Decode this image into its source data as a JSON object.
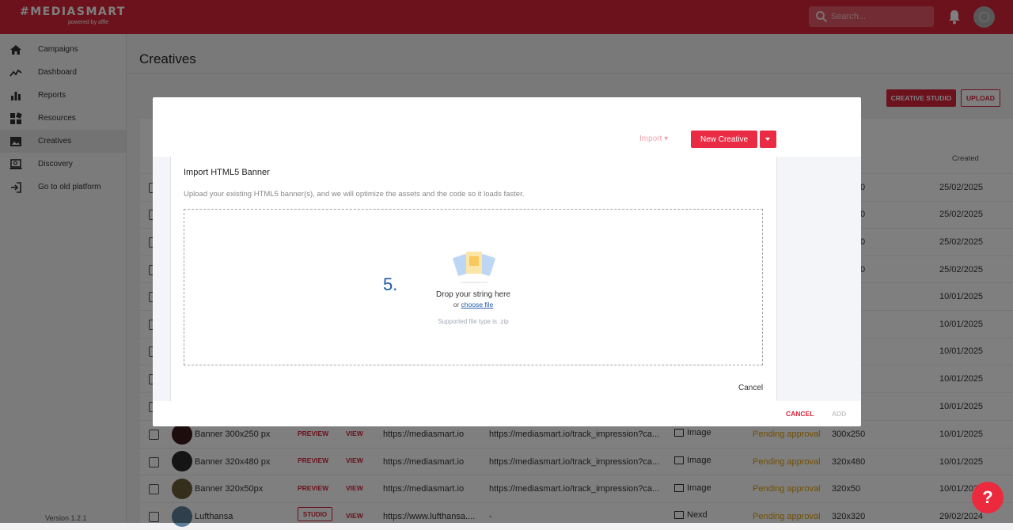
{
  "header": {
    "logo": "#MEDIASMART",
    "logo_sub": "powered by affle",
    "search_placeholder": "Search..."
  },
  "sidebar": {
    "items": [
      {
        "label": "Campaigns"
      },
      {
        "label": "Dashboard"
      },
      {
        "label": "Reports"
      },
      {
        "label": "Resources"
      },
      {
        "label": "Creatives"
      },
      {
        "label": "Discovery"
      },
      {
        "label": "Go to old platform"
      }
    ],
    "version": "Version 1.2.1"
  },
  "page": {
    "title": "Creatives",
    "creative_studio": "CREATIVE STUDIO",
    "upload": "UPLOAD",
    "col_created": "Created"
  },
  "rows_bg": [
    {
      "date": "25/02/2025",
      "size": "0"
    },
    {
      "date": "25/02/2025",
      "size": "0"
    },
    {
      "date": "25/02/2025",
      "size": "0"
    },
    {
      "date": "25/02/2025",
      "size": "0"
    },
    {
      "date": "10/01/2025",
      "size": ""
    },
    {
      "date": "10/01/2025",
      "size": ""
    },
    {
      "date": "10/01/2025",
      "size": ""
    },
    {
      "date": "10/01/2025",
      "size": ""
    },
    {
      "date": "10/01/2025",
      "size": ""
    }
  ],
  "rows": [
    {
      "name": "Banner 300x250 px",
      "action": "PREVIEW",
      "view": "VIEW",
      "url1": "https://mediasmart.io",
      "url2": "https://mediasmart.io/track_impression?ca...",
      "type": "Image",
      "status": "Pending approval",
      "size": "300x250",
      "date": "10/01/2025"
    },
    {
      "name": "Banner 320x480 px",
      "action": "PREVIEW",
      "view": "VIEW",
      "url1": "https://mediasmart.io",
      "url2": "https://mediasmart.io/track_impression?ca...",
      "type": "Image",
      "status": "Pending approval",
      "size": "320x480",
      "date": "10/01/2025"
    },
    {
      "name": "Banner 320x50px",
      "action": "PREVIEW",
      "view": "VIEW",
      "url1": "https://mediasmart.io",
      "url2": "https://mediasmart.io/track_impression?ca...",
      "type": "Image",
      "status": "Pending approval",
      "size": "320x50",
      "date": "10/01/2025"
    },
    {
      "name": "Lufthansa",
      "action": "STUDIO",
      "view": "VIEW",
      "url1": "https://www.lufthansa....",
      "url2": "-",
      "type": "Nexd",
      "status": "Pending approval",
      "size": "320x320",
      "date": "29/02/2024"
    }
  ],
  "modal": {
    "import_label": "Import",
    "new_creative": "New Creative",
    "card_title": "Import HTML5 Banner",
    "card_desc": "Upload your existing HTML5 banner(s), and we will optimize the assets and the code so it loads faster.",
    "step": "5.",
    "drop_text": "Drop your string here",
    "or_text": "or",
    "choose_file": "choose file",
    "supported": "Supported file type is .zip",
    "card_cancel": "Cancel",
    "cancel": "CANCEL",
    "add": "ADD"
  },
  "help": "?"
}
